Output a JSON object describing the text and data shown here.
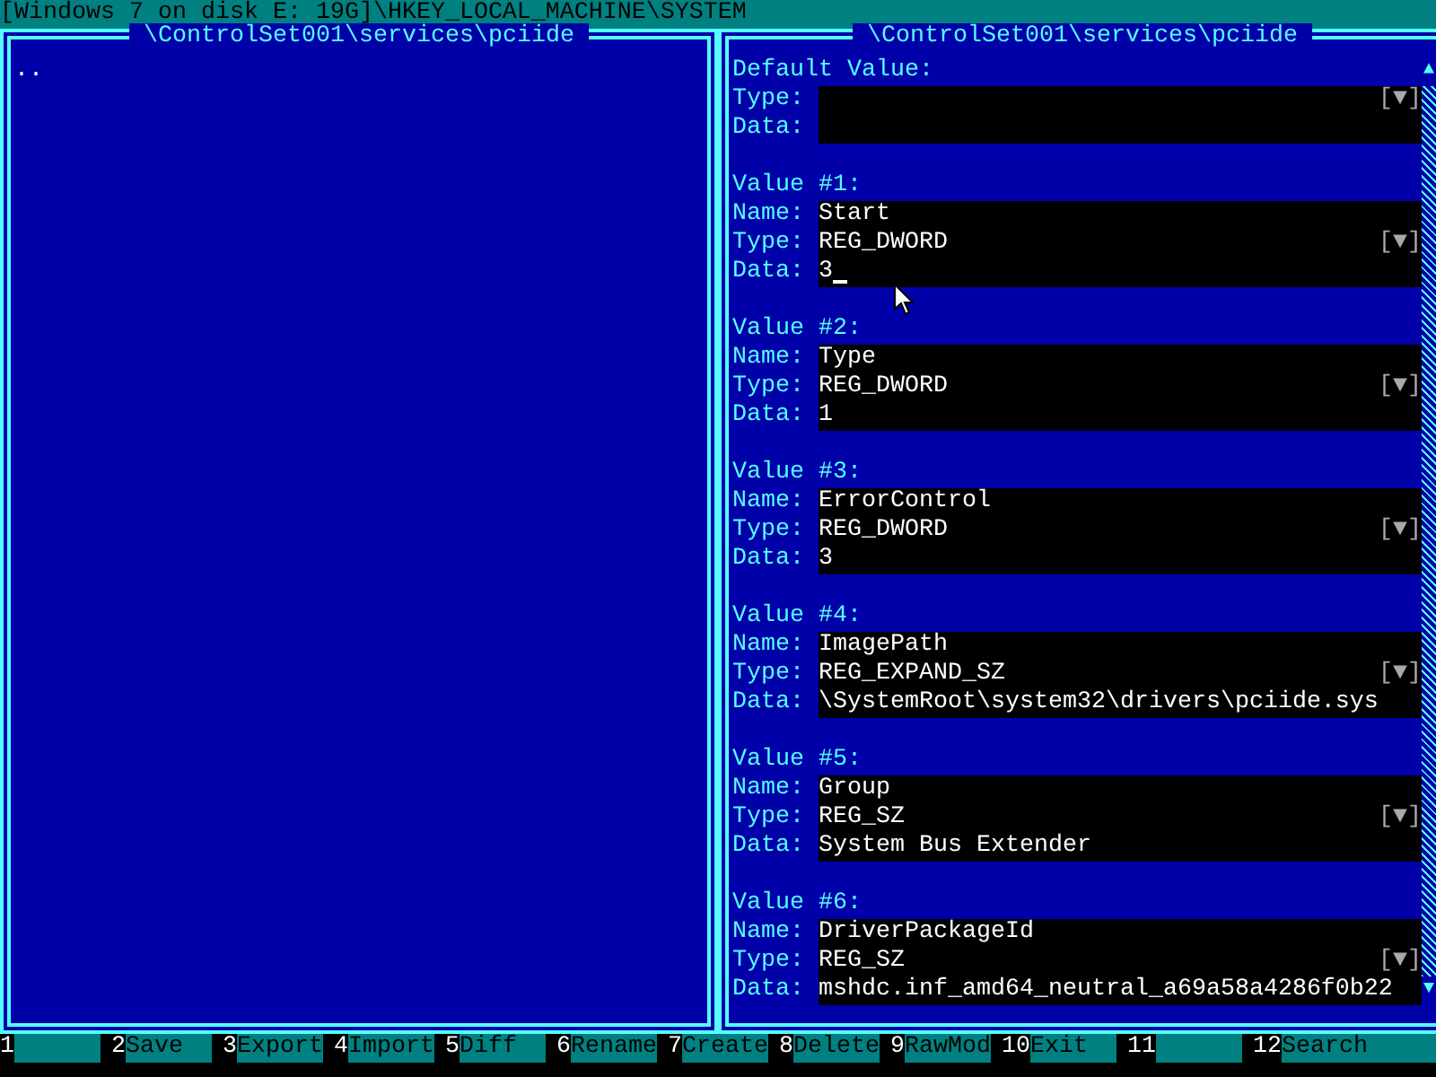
{
  "title_bar": "[Windows 7 on disk E: 19G]\\HKEY_LOCAL_MACHINE\\SYSTEM",
  "left_panel": {
    "title": "\\ControlSet001\\services\\pciide",
    "items": [
      {
        "label": "..",
        "selected": false
      }
    ]
  },
  "right_panel": {
    "title": "\\ControlSet001\\services\\pciide",
    "scroll_up": "▲",
    "scroll_down": "▼",
    "values": [
      {
        "heading": "Default Value:",
        "fields": [
          {
            "label": "Type:",
            "dropdown": "[▼]",
            "focused": false
          },
          {
            "label": "Data:",
            "focused": false
          }
        ]
      },
      {
        "heading": "Value #1:",
        "fields": [
          {
            "label": "Name:",
            "value": "Start",
            "focused": false
          },
          {
            "label": "Type:",
            "value": "REG_DWORD",
            "dropdown": "[▼]",
            "focused": false
          },
          {
            "label": "Data:",
            "value": "3",
            "focused": true
          }
        ]
      },
      {
        "heading": "Value #2:",
        "fields": [
          {
            "label": "Name:",
            "value": "Type",
            "focused": false
          },
          {
            "label": "Type:",
            "value": "REG_DWORD",
            "dropdown": "[▼]",
            "focused": false
          },
          {
            "label": "Data:",
            "value": "1",
            "focused": false
          }
        ]
      },
      {
        "heading": "Value #3:",
        "fields": [
          {
            "label": "Name:",
            "value": "ErrorControl",
            "focused": false
          },
          {
            "label": "Type:",
            "value": "REG_DWORD",
            "dropdown": "[▼]",
            "focused": false
          },
          {
            "label": "Data:",
            "value": "3",
            "focused": false
          }
        ]
      },
      {
        "heading": "Value #4:",
        "fields": [
          {
            "label": "Name:",
            "value": "ImagePath",
            "focused": false
          },
          {
            "label": "Type:",
            "value": "REG_EXPAND_SZ",
            "dropdown": "[▼]",
            "focused": false
          },
          {
            "label": "Data:",
            "value": "\\SystemRoot\\system32\\drivers\\pciide.sys",
            "focused": false
          }
        ]
      },
      {
        "heading": "Value #5:",
        "fields": [
          {
            "label": "Name:",
            "value": "Group",
            "focused": false
          },
          {
            "label": "Type:",
            "value": "REG_SZ",
            "dropdown": "[▼]",
            "focused": false
          },
          {
            "label": "Data:",
            "value": "System Bus Extender",
            "focused": false
          }
        ]
      },
      {
        "heading": "Value #6:",
        "fields": [
          {
            "label": "Name:",
            "value": "DriverPackageId",
            "focused": false
          },
          {
            "label": "Type:",
            "value": "REG_SZ",
            "dropdown": "[▼]",
            "focused": false
          },
          {
            "label": "Data:",
            "value": "mshdc.inf_amd64_neutral_a69a58a4286f0b22",
            "focused": false
          }
        ]
      }
    ]
  },
  "function_keys": [
    {
      "number": "1"
    },
    {
      "number": "2",
      "label": "Save"
    },
    {
      "number": "3",
      "label": "Export"
    },
    {
      "number": "4",
      "label": "Import"
    },
    {
      "number": "5",
      "label": "Diff"
    },
    {
      "number": "6",
      "label": "Rename"
    },
    {
      "number": "7",
      "label": "Create"
    },
    {
      "number": "8",
      "label": "Delete"
    },
    {
      "number": "9",
      "label": "RawMod"
    },
    {
      "number": "10",
      "label": "Exit"
    },
    {
      "number": "11"
    },
    {
      "number": "12",
      "label": "Search"
    }
  ]
}
